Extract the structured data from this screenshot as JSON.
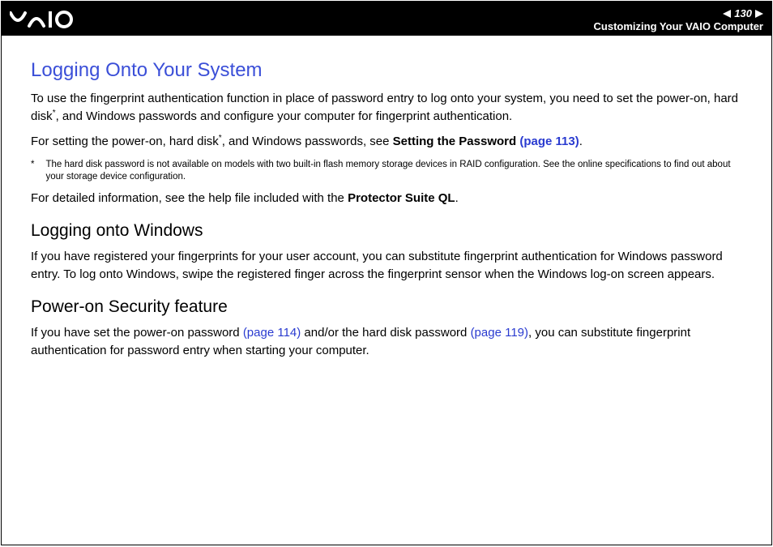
{
  "header": {
    "page_number": "130",
    "section": "Customizing Your VAIO Computer"
  },
  "content": {
    "title": "Logging Onto Your System",
    "p1_a": "To use the fingerprint authentication function in place of password entry to log onto your system, you need to set the power-on, hard disk",
    "p1_sup": "*",
    "p1_b": ", and Windows passwords and configure your computer for fingerprint authentication.",
    "p2_a": "For setting the power-on, hard disk",
    "p2_sup": "*",
    "p2_b": ", and Windows passwords, see ",
    "p2_bold": "Setting the Password ",
    "p2_link": "(page 113)",
    "p2_c": ".",
    "footnote_star": "*",
    "footnote_text": "The hard disk password is not available on models with two built-in flash memory storage devices in RAID configuration. See the online specifications to find out about your storage device configuration.",
    "p3_a": "For detailed information, see the help file included with the ",
    "p3_bold": "Protector Suite QL",
    "p3_b": ".",
    "h2a": "Logging onto Windows",
    "p4": "If you have registered your fingerprints for your user account, you can substitute fingerprint authentication for Windows password entry. To log onto Windows, swipe the registered finger across the fingerprint sensor when the Windows log-on screen appears.",
    "h2b": "Power-on Security feature",
    "p5_a": "If you have set the power-on password ",
    "p5_link1": "(page 114)",
    "p5_b": " and/or the hard disk password ",
    "p5_link2": "(page 119)",
    "p5_c": ", you can substitute fingerprint authentication for password entry when starting your computer."
  }
}
